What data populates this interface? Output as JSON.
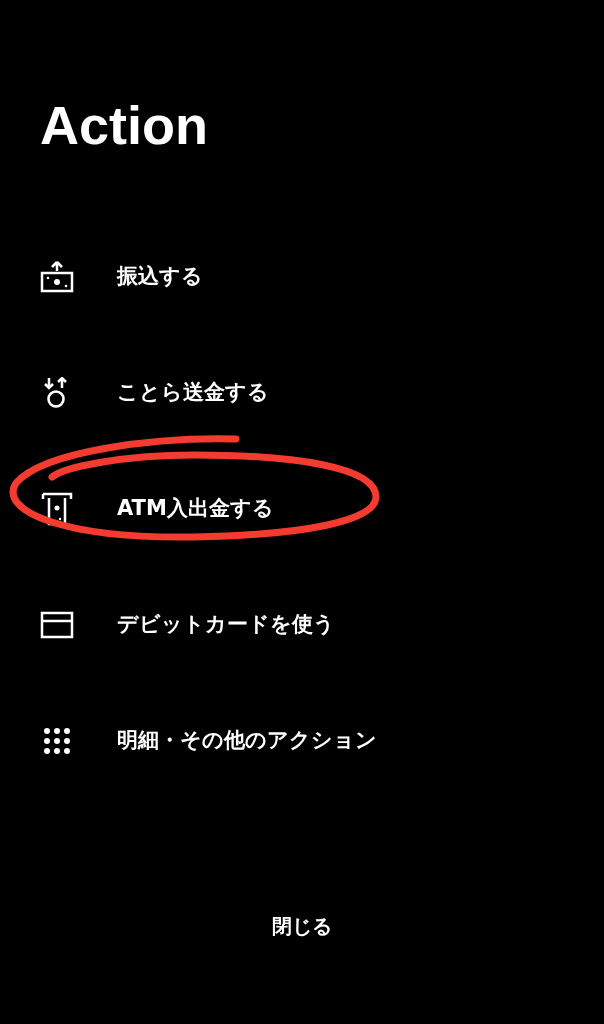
{
  "title": "Action",
  "actions": [
    {
      "label": "振込する",
      "circled": false
    },
    {
      "label": "ことら送金する",
      "circled": false
    },
    {
      "label": "ATM入出金する",
      "circled": true
    },
    {
      "label": "デビットカードを使う",
      "circled": false
    },
    {
      "label": "明細・その他のアクション",
      "circled": false
    }
  ],
  "close_button": "閉じる"
}
